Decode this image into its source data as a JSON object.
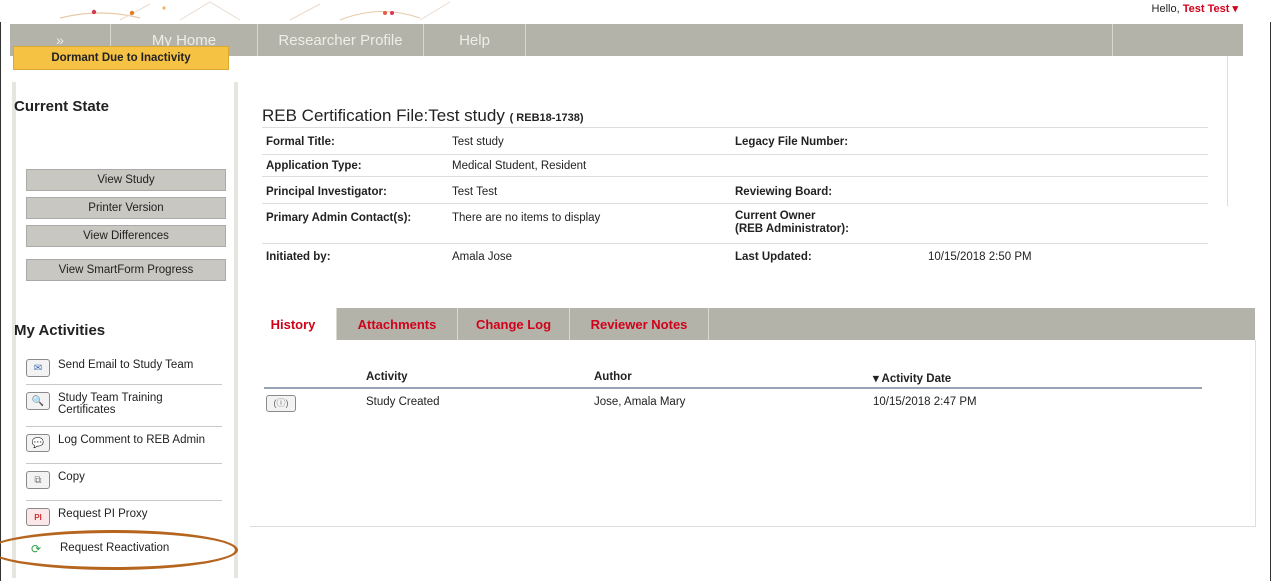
{
  "header": {
    "greeting": "Hello, ",
    "user": "Test Test",
    "user_menu_icon": "caret-down-icon"
  },
  "nav": {
    "expand_label": "»",
    "items": [
      "My Home",
      "Researcher Profile",
      "Help"
    ]
  },
  "sidebar": {
    "current_state_title": "Current State",
    "state": "Dormant Due to Inactivity",
    "buttons": [
      "View Study",
      "Printer Version",
      "View Differences",
      "View SmartForm Progress"
    ],
    "activities_title": "My Activities",
    "activities": [
      {
        "label": "Send Email to Study Team",
        "icon": "email-icon"
      },
      {
        "label": "Study Team Training Certificates",
        "icon": "certificate-icon"
      },
      {
        "label": "Log Comment to REB Admin",
        "icon": "comment-icon"
      },
      {
        "label": "Copy",
        "icon": "copy-icon"
      },
      {
        "label": "Request PI Proxy",
        "icon": "pi-proxy-icon"
      },
      {
        "label": "Request Reactivation",
        "icon": "reactivation-icon"
      }
    ]
  },
  "record": {
    "title_prefix": "REB Certification File:",
    "title": "Test study",
    "code": "( REB18-1738)",
    "fields": {
      "formal_title_label": "Formal Title:",
      "formal_title": "Test study",
      "legacy_label": "Legacy File Number:",
      "application_type_label": "Application Type:",
      "application_type": "Medical Student, Resident",
      "pi_label": "Principal Investigator:",
      "pi": "Test Test",
      "reviewing_board_label": "Reviewing Board:",
      "admin_contact_label": "Primary Admin Contact(s):",
      "admin_contact": "There are no items to display",
      "current_owner_label": "Current Owner",
      "current_owner_sub": "(REB Administrator):",
      "initiated_by_label": "Initiated by:",
      "initiated_by": "Amala Jose",
      "last_updated_label": "Last Updated:",
      "last_updated": "10/15/2018 2:50 PM"
    }
  },
  "tabs": [
    "History",
    "Attachments",
    "Change Log",
    "Reviewer Notes"
  ],
  "history": {
    "columns": [
      "Activity",
      "Author",
      "▾ Activity Date"
    ],
    "rows": [
      {
        "icon": "study-created-icon",
        "activity": "Study Created",
        "author": "Jose, Amala Mary",
        "date": "10/15/2018 2:47 PM"
      }
    ]
  },
  "colors": {
    "nav_bg": "#b4b3a9",
    "state_badge": "#f6c244",
    "tab_text": "#d0021b",
    "highlight_oval": "#b5651d"
  }
}
